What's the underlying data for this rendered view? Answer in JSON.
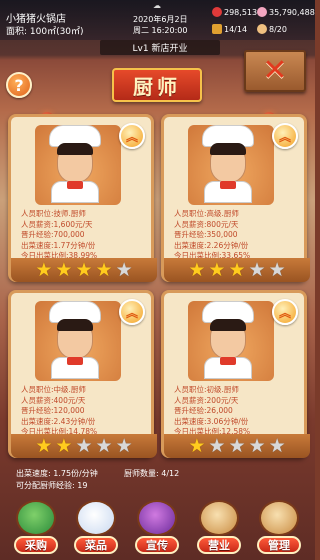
{
  "topbar": {
    "shop_name": "小猪猪火锅店",
    "shop_area": "面积: 100㎡(30㎡)",
    "weather_icon": "cloud-icon",
    "date": "2020年6月2日",
    "time": "周二 16:20:00",
    "money": "298,513",
    "gems": "35,790,488",
    "tables": "14/14",
    "staff": "8/20"
  },
  "level_text": "Lv1 新店开业",
  "title": "厨师",
  "close_symbol": "✕",
  "help_symbol": "?",
  "labels": {
    "position": "人员职位: ",
    "salary": "人员薪资: ",
    "exp": "晋升经验: ",
    "speed": "出菜速度: ",
    "ratio": "今日出菜比例: "
  },
  "chefs": [
    {
      "position": "技师.厨师",
      "salary": "1,600元/天",
      "exp": "700,000",
      "speed": "1.77分钟/份",
      "ratio": "38.99%",
      "stars": 4
    },
    {
      "position": "高级.厨师",
      "salary": "800元/天",
      "exp": "350,000",
      "speed": "2.26分钟/份",
      "ratio": "33.65%",
      "stars": 3
    },
    {
      "position": "中级.厨师",
      "salary": "400元/天",
      "exp": "120,000",
      "speed": "2.43分钟/份",
      "ratio": "14.78%",
      "stars": 2
    },
    {
      "position": "初级.厨师",
      "salary": "200元/天",
      "exp": "26,000",
      "speed": "3.06分钟/份",
      "ratio": "12.58%",
      "stars": 1
    }
  ],
  "summary": {
    "speed": "出菜速度: 1.75份/分钟",
    "count": "厨师数量: 4/12",
    "exp": "可分配厨师经验: 19"
  },
  "nav": [
    {
      "label": "采购",
      "icon": "vegetables-icon"
    },
    {
      "label": "菜品",
      "icon": "dish-icon"
    },
    {
      "label": "宣传",
      "icon": "film-icon"
    },
    {
      "label": "营业",
      "icon": "waiter-icon"
    },
    {
      "label": "管理",
      "icon": "manager-icon"
    }
  ],
  "colors": {
    "accent": "#e64a2a",
    "card_bg": "#f6e6c6",
    "star_on": "#ffcc1e",
    "star_off": "#d8d8d8"
  }
}
